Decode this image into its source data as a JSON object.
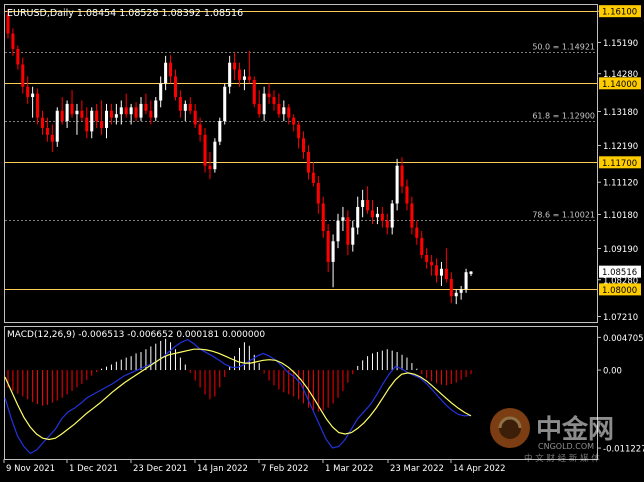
{
  "header": {
    "symbol_line": "EURUSD,Daily  1.08454 1.08528 1.08392 1.08516"
  },
  "colors": {
    "background": "#000000",
    "frame": "#c0c0c0",
    "text": "#ffffff",
    "bull_candle": "#ffffff",
    "bear_candle": "#ff0000",
    "price_level_line": "#ffcc55",
    "price_level_label_bg": "#ffcc00",
    "fib_line": "#808080",
    "current_price_bg": "#ffffff",
    "macd_hist_pos": "#ffffff",
    "macd_hist_neg": "#ff0000",
    "macd_line": "#2233dd",
    "signal_line": "#ffff66"
  },
  "price_axis": {
    "ticks": [
      "1.16100",
      "1.15190",
      "1.14280",
      "1.13180",
      "1.12190",
      "1.11120",
      "1.10180",
      "1.09190",
      "1.08280",
      "1.07210"
    ],
    "current_price": "1.08516"
  },
  "levels": [
    {
      "label": "1.16100",
      "value": 1.161
    },
    {
      "label": "1.14000",
      "value": 1.14
    },
    {
      "label": "1.11700",
      "value": 1.117
    },
    {
      "label": "1.08000",
      "value": 1.08
    }
  ],
  "fib_levels": [
    {
      "label": "50.0 = 1.14921",
      "value": 1.14921
    },
    {
      "label": "61.8 = 1.12900",
      "value": 1.129
    },
    {
      "label": "78.6 = 1.10021",
      "value": 1.10021
    }
  ],
  "macd": {
    "title": "MACD(12,26,9) -0.006513 -0.006652 0.000181 0.000000",
    "ticks": [
      "0.004705",
      "0.00",
      "-0.011227"
    ]
  },
  "time_axis": {
    "labels": [
      "9 Nov 2021",
      "1 Dec 2021",
      "23 Dec 2021",
      "14 Jan 2022",
      "7 Feb 2022",
      "1 Mar 2022",
      "23 Mar 2022",
      "14 Apr 2022"
    ]
  },
  "watermark": {
    "brand": "中金网",
    "domain": "CNGOLD.COM",
    "slogan": "中 文 财 经 新 媒 体"
  },
  "chart_data": {
    "type": "candlestick",
    "symbol": "EURUSD",
    "timeframe": "Daily",
    "candles": [
      {
        "o": 1.16,
        "h": 1.1617,
        "l": 1.153,
        "c": 1.1545
      },
      {
        "o": 1.1545,
        "h": 1.156,
        "l": 1.148,
        "c": 1.15
      },
      {
        "o": 1.15,
        "h": 1.151,
        "l": 1.144,
        "c": 1.1455
      },
      {
        "o": 1.1455,
        "h": 1.1475,
        "l": 1.137,
        "c": 1.139
      },
      {
        "o": 1.139,
        "h": 1.142,
        "l": 1.134,
        "c": 1.136
      },
      {
        "o": 1.136,
        "h": 1.139,
        "l": 1.13,
        "c": 1.137
      },
      {
        "o": 1.137,
        "h": 1.1385,
        "l": 1.128,
        "c": 1.13
      },
      {
        "o": 1.13,
        "h": 1.132,
        "l": 1.125,
        "c": 1.127
      },
      {
        "o": 1.127,
        "h": 1.13,
        "l": 1.123,
        "c": 1.125
      },
      {
        "o": 1.125,
        "h": 1.128,
        "l": 1.12,
        "c": 1.123
      },
      {
        "o": 1.123,
        "h": 1.133,
        "l": 1.1215,
        "c": 1.132
      },
      {
        "o": 1.132,
        "h": 1.136,
        "l": 1.128,
        "c": 1.129
      },
      {
        "o": 1.129,
        "h": 1.135,
        "l": 1.127,
        "c": 1.134
      },
      {
        "o": 1.134,
        "h": 1.138,
        "l": 1.13,
        "c": 1.131
      },
      {
        "o": 1.131,
        "h": 1.134,
        "l": 1.125,
        "c": 1.132
      },
      {
        "o": 1.132,
        "h": 1.135,
        "l": 1.129,
        "c": 1.13
      },
      {
        "o": 1.13,
        "h": 1.133,
        "l": 1.124,
        "c": 1.126
      },
      {
        "o": 1.126,
        "h": 1.133,
        "l": 1.124,
        "c": 1.132
      },
      {
        "o": 1.132,
        "h": 1.134,
        "l": 1.127,
        "c": 1.129
      },
      {
        "o": 1.129,
        "h": 1.135,
        "l": 1.125,
        "c": 1.127
      },
      {
        "o": 1.127,
        "h": 1.134,
        "l": 1.124,
        "c": 1.132
      },
      {
        "o": 1.132,
        "h": 1.134,
        "l": 1.128,
        "c": 1.13
      },
      {
        "o": 1.13,
        "h": 1.134,
        "l": 1.128,
        "c": 1.131
      },
      {
        "o": 1.131,
        "h": 1.135,
        "l": 1.128,
        "c": 1.133
      },
      {
        "o": 1.133,
        "h": 1.137,
        "l": 1.13,
        "c": 1.131
      },
      {
        "o": 1.131,
        "h": 1.134,
        "l": 1.128,
        "c": 1.133
      },
      {
        "o": 1.133,
        "h": 1.1345,
        "l": 1.129,
        "c": 1.13
      },
      {
        "o": 1.13,
        "h": 1.136,
        "l": 1.129,
        "c": 1.134
      },
      {
        "o": 1.134,
        "h": 1.137,
        "l": 1.131,
        "c": 1.132
      },
      {
        "o": 1.132,
        "h": 1.135,
        "l": 1.128,
        "c": 1.13
      },
      {
        "o": 1.13,
        "h": 1.136,
        "l": 1.129,
        "c": 1.135
      },
      {
        "o": 1.135,
        "h": 1.142,
        "l": 1.133,
        "c": 1.14
      },
      {
        "o": 1.14,
        "h": 1.148,
        "l": 1.138,
        "c": 1.146
      },
      {
        "o": 1.146,
        "h": 1.1482,
        "l": 1.14,
        "c": 1.142
      },
      {
        "o": 1.142,
        "h": 1.144,
        "l": 1.135,
        "c": 1.136
      },
      {
        "o": 1.136,
        "h": 1.138,
        "l": 1.13,
        "c": 1.132
      },
      {
        "o": 1.132,
        "h": 1.135,
        "l": 1.129,
        "c": 1.134
      },
      {
        "o": 1.134,
        "h": 1.136,
        "l": 1.131,
        "c": 1.132
      },
      {
        "o": 1.132,
        "h": 1.134,
        "l": 1.127,
        "c": 1.128
      },
      {
        "o": 1.128,
        "h": 1.13,
        "l": 1.123,
        "c": 1.125
      },
      {
        "o": 1.125,
        "h": 1.127,
        "l": 1.114,
        "c": 1.116
      },
      {
        "o": 1.116,
        "h": 1.12,
        "l": 1.1121,
        "c": 1.115
      },
      {
        "o": 1.115,
        "h": 1.124,
        "l": 1.114,
        "c": 1.123
      },
      {
        "o": 1.123,
        "h": 1.13,
        "l": 1.122,
        "c": 1.129
      },
      {
        "o": 1.129,
        "h": 1.14,
        "l": 1.128,
        "c": 1.139
      },
      {
        "o": 1.139,
        "h": 1.148,
        "l": 1.137,
        "c": 1.146
      },
      {
        "o": 1.146,
        "h": 1.149,
        "l": 1.141,
        "c": 1.144
      },
      {
        "o": 1.144,
        "h": 1.146,
        "l": 1.139,
        "c": 1.141
      },
      {
        "o": 1.141,
        "h": 1.144,
        "l": 1.138,
        "c": 1.142
      },
      {
        "o": 1.142,
        "h": 1.1495,
        "l": 1.14,
        "c": 1.141
      },
      {
        "o": 1.141,
        "h": 1.142,
        "l": 1.133,
        "c": 1.134
      },
      {
        "o": 1.134,
        "h": 1.138,
        "l": 1.13,
        "c": 1.131
      },
      {
        "o": 1.131,
        "h": 1.139,
        "l": 1.129,
        "c": 1.137
      },
      {
        "o": 1.137,
        "h": 1.14,
        "l": 1.134,
        "c": 1.136
      },
      {
        "o": 1.136,
        "h": 1.138,
        "l": 1.132,
        "c": 1.134
      },
      {
        "o": 1.134,
        "h": 1.137,
        "l": 1.13,
        "c": 1.131
      },
      {
        "o": 1.131,
        "h": 1.135,
        "l": 1.129,
        "c": 1.133
      },
      {
        "o": 1.133,
        "h": 1.134,
        "l": 1.128,
        "c": 1.13
      },
      {
        "o": 1.13,
        "h": 1.131,
        "l": 1.126,
        "c": 1.128
      },
      {
        "o": 1.128,
        "h": 1.129,
        "l": 1.121,
        "c": 1.124
      },
      {
        "o": 1.124,
        "h": 1.126,
        "l": 1.118,
        "c": 1.12
      },
      {
        "o": 1.12,
        "h": 1.122,
        "l": 1.112,
        "c": 1.114
      },
      {
        "o": 1.114,
        "h": 1.117,
        "l": 1.11,
        "c": 1.111
      },
      {
        "o": 1.111,
        "h": 1.113,
        "l": 1.102,
        "c": 1.105
      },
      {
        "o": 1.105,
        "h": 1.107,
        "l": 1.095,
        "c": 1.097
      },
      {
        "o": 1.097,
        "h": 1.099,
        "l": 1.085,
        "c": 1.088
      },
      {
        "o": 1.088,
        "h": 1.096,
        "l": 1.0806,
        "c": 1.094
      },
      {
        "o": 1.094,
        "h": 1.102,
        "l": 1.092,
        "c": 1.1
      },
      {
        "o": 1.1,
        "h": 1.104,
        "l": 1.097,
        "c": 1.101
      },
      {
        "o": 1.101,
        "h": 1.103,
        "l": 1.09,
        "c": 1.093
      },
      {
        "o": 1.093,
        "h": 1.1,
        "l": 1.091,
        "c": 1.098
      },
      {
        "o": 1.098,
        "h": 1.107,
        "l": 1.096,
        "c": 1.104
      },
      {
        "o": 1.104,
        "h": 1.109,
        "l": 1.101,
        "c": 1.106
      },
      {
        "o": 1.106,
        "h": 1.11,
        "l": 1.102,
        "c": 1.103
      },
      {
        "o": 1.103,
        "h": 1.106,
        "l": 1.099,
        "c": 1.101
      },
      {
        "o": 1.101,
        "h": 1.104,
        "l": 1.099,
        "c": 1.102
      },
      {
        "o": 1.102,
        "h": 1.104,
        "l": 1.098,
        "c": 1.1
      },
      {
        "o": 1.1,
        "h": 1.102,
        "l": 1.096,
        "c": 1.098
      },
      {
        "o": 1.098,
        "h": 1.106,
        "l": 1.096,
        "c": 1.105
      },
      {
        "o": 1.105,
        "h": 1.118,
        "l": 1.103,
        "c": 1.116
      },
      {
        "o": 1.116,
        "h": 1.1185,
        "l": 1.108,
        "c": 1.11
      },
      {
        "o": 1.11,
        "h": 1.112,
        "l": 1.103,
        "c": 1.105
      },
      {
        "o": 1.105,
        "h": 1.107,
        "l": 1.096,
        "c": 1.098
      },
      {
        "o": 1.098,
        "h": 1.1,
        "l": 1.093,
        "c": 1.095
      },
      {
        "o": 1.095,
        "h": 1.097,
        "l": 1.089,
        "c": 1.09
      },
      {
        "o": 1.09,
        "h": 1.092,
        "l": 1.086,
        "c": 1.088
      },
      {
        "o": 1.088,
        "h": 1.09,
        "l": 1.084,
        "c": 1.087
      },
      {
        "o": 1.087,
        "h": 1.089,
        "l": 1.082,
        "c": 1.084
      },
      {
        "o": 1.084,
        "h": 1.088,
        "l": 1.081,
        "c": 1.086
      },
      {
        "o": 1.086,
        "h": 1.092,
        "l": 1.082,
        "c": 1.083
      },
      {
        "o": 1.083,
        "h": 1.085,
        "l": 1.076,
        "c": 1.078
      },
      {
        "o": 1.078,
        "h": 1.08,
        "l": 1.0757,
        "c": 1.079
      },
      {
        "o": 1.079,
        "h": 1.081,
        "l": 1.077,
        "c": 1.08
      },
      {
        "o": 1.08,
        "h": 1.086,
        "l": 1.079,
        "c": 1.085
      },
      {
        "o": 1.0845,
        "h": 1.0853,
        "l": 1.0839,
        "c": 1.0852
      }
    ],
    "macd_histogram": [
      -0.0025,
      -0.003,
      -0.0034,
      -0.0038,
      -0.0042,
      -0.0046,
      -0.0049,
      -0.0051,
      -0.005,
      -0.0047,
      -0.0044,
      -0.004,
      -0.0035,
      -0.003,
      -0.0025,
      -0.002,
      -0.0014,
      -0.0008,
      -0.0003,
      0.0002,
      0.0005,
      0.0008,
      0.0012,
      0.0015,
      0.0018,
      0.002,
      0.0024,
      0.0026,
      0.003,
      0.0034,
      0.0038,
      0.0042,
      0.0045,
      0.004,
      0.003,
      0.0018,
      0.0008,
      -0.0004,
      -0.0015,
      -0.0025,
      -0.0035,
      -0.0042,
      -0.0038,
      -0.0025,
      -0.001,
      0.0005,
      0.002,
      0.0032,
      0.004,
      0.0035,
      0.0022,
      0.001,
      -0.0005,
      -0.0015,
      -0.0022,
      -0.0028,
      -0.0032,
      -0.0035,
      -0.0038,
      -0.0042,
      -0.0048,
      -0.0054,
      -0.0058,
      -0.006,
      -0.0058,
      -0.0054,
      -0.0048,
      -0.004,
      -0.003,
      -0.0018,
      -0.0006,
      0.0006,
      0.0014,
      0.002,
      0.0024,
      0.0026,
      0.0028,
      0.003,
      0.0028,
      0.0026,
      0.0022,
      0.0018,
      0.001,
      0.0002,
      -0.0006,
      -0.0012,
      -0.0016,
      -0.0019,
      -0.0021,
      -0.0022,
      -0.002,
      -0.0018,
      -0.0014,
      -0.001,
      -0.0006
    ],
    "macd_line": [
      -0.004,
      -0.007,
      -0.0095,
      -0.011,
      -0.012,
      -0.0115,
      -0.0105,
      -0.0095,
      -0.0085,
      -0.007,
      -0.006,
      -0.0055,
      -0.0048,
      -0.004,
      -0.0035,
      -0.003,
      -0.0025,
      -0.002,
      -0.0014,
      -0.0008,
      -0.0004,
      0.0,
      0.0004,
      0.0008,
      0.0012,
      0.0018,
      0.0026,
      0.0034,
      0.004,
      0.0044,
      0.0038,
      0.003,
      0.0025,
      0.002,
      0.0014,
      0.0008,
      0.0004,
      0.0004,
      0.0008,
      0.0014,
      0.002,
      0.0024,
      0.002,
      0.0014,
      0.0006,
      -0.0004,
      -0.001,
      -0.002,
      -0.004,
      -0.006,
      -0.008,
      -0.01,
      -0.0112,
      -0.011,
      -0.01,
      -0.0085,
      -0.007,
      -0.006,
      -0.005,
      -0.0036,
      -0.002,
      -0.0006,
      0.0005,
      0.0002,
      -0.0004,
      -0.0008,
      -0.0012,
      -0.002,
      -0.003,
      -0.004,
      -0.005,
      -0.0058,
      -0.0064,
      -0.0066,
      -0.0065
    ],
    "signal_line": [
      -0.001,
      -0.003,
      -0.005,
      -0.0068,
      -0.0082,
      -0.0092,
      -0.0098,
      -0.01,
      -0.0098,
      -0.0092,
      -0.0085,
      -0.0078,
      -0.007,
      -0.0062,
      -0.0055,
      -0.0048,
      -0.004,
      -0.0032,
      -0.0025,
      -0.0018,
      -0.0012,
      -0.0006,
      0.0,
      0.0006,
      0.0012,
      0.0018,
      0.0022,
      0.0024,
      0.0026,
      0.0028,
      0.003,
      0.003,
      0.0029,
      0.0027,
      0.0024,
      0.002,
      0.0016,
      0.0012,
      0.001,
      0.001,
      0.0012,
      0.0014,
      0.0015,
      0.0014,
      0.001,
      0.0004,
      -0.0004,
      -0.0014,
      -0.0026,
      -0.004,
      -0.0055,
      -0.007,
      -0.0082,
      -0.009,
      -0.0092,
      -0.009,
      -0.0084,
      -0.0076,
      -0.0066,
      -0.0054,
      -0.004,
      -0.0026,
      -0.0014,
      -0.0006,
      -0.0004,
      -0.0006,
      -0.001,
      -0.0016,
      -0.0024,
      -0.0032,
      -0.004,
      -0.0048,
      -0.0055,
      -0.0061,
      -0.0066
    ]
  }
}
